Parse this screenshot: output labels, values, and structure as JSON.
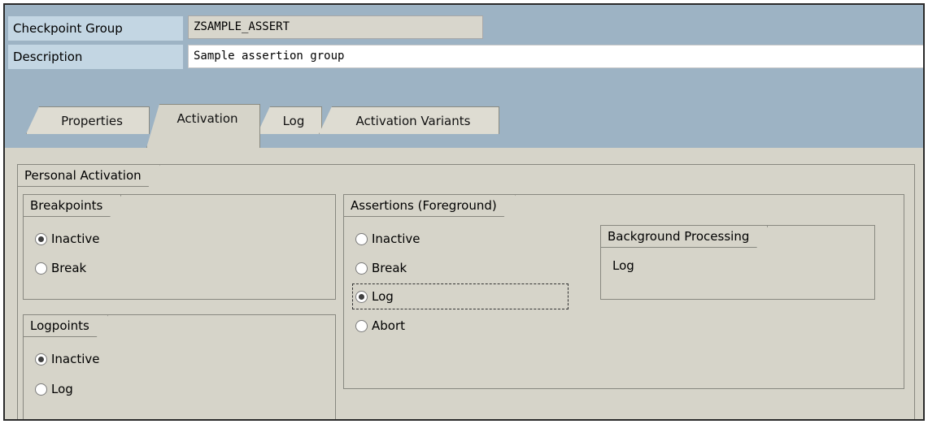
{
  "header": {
    "checkpoint_group_label": "Checkpoint Group",
    "checkpoint_group_value": "ZSAMPLE_ASSERT",
    "description_label": "Description",
    "description_value": "Sample assertion group"
  },
  "tabs": [
    {
      "label": "Properties",
      "active": false
    },
    {
      "label": "Activation",
      "active": true
    },
    {
      "label": "Log",
      "active": false
    },
    {
      "label": "Activation Variants",
      "active": false
    }
  ],
  "personal_activation": {
    "title": "Personal Activation",
    "breakpoints": {
      "title": "Breakpoints",
      "options": [
        {
          "label": "Inactive",
          "checked": true
        },
        {
          "label": "Break",
          "checked": false
        }
      ]
    },
    "logpoints": {
      "title": "Logpoints",
      "options": [
        {
          "label": "Inactive",
          "checked": true
        },
        {
          "label": "Log",
          "checked": false
        }
      ]
    },
    "assertions": {
      "title": "Assertions (Foreground)",
      "options": [
        {
          "label": "Inactive",
          "checked": false
        },
        {
          "label": "Break",
          "checked": false
        },
        {
          "label": "Log",
          "checked": true
        },
        {
          "label": "Abort",
          "checked": false
        }
      ]
    },
    "background": {
      "title": "Background Processing",
      "value": "Log"
    }
  },
  "colors": {
    "header_bg": "#9db3c4",
    "label_bg": "#c3d6e3",
    "panel_bg": "#d6d4c9"
  }
}
